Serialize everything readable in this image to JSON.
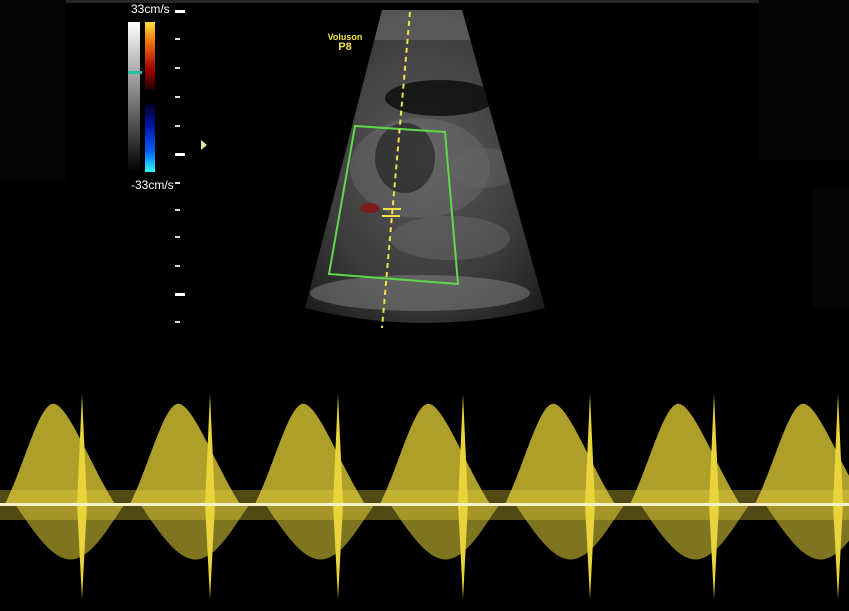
{
  "colorscale": {
    "max_label": "33cm/s",
    "min_label": "-33cm/s",
    "positive_color": "#d8b020",
    "negative_color": "#20a0ff"
  },
  "brand": {
    "name": "Voluson",
    "model": "P8"
  },
  "colors": {
    "background": "#000000",
    "cursor_line": "#f0e04a",
    "sample_box": "#5fd84a",
    "spectrum": "#e8d43a",
    "baseline": "#f4f0c8"
  }
}
